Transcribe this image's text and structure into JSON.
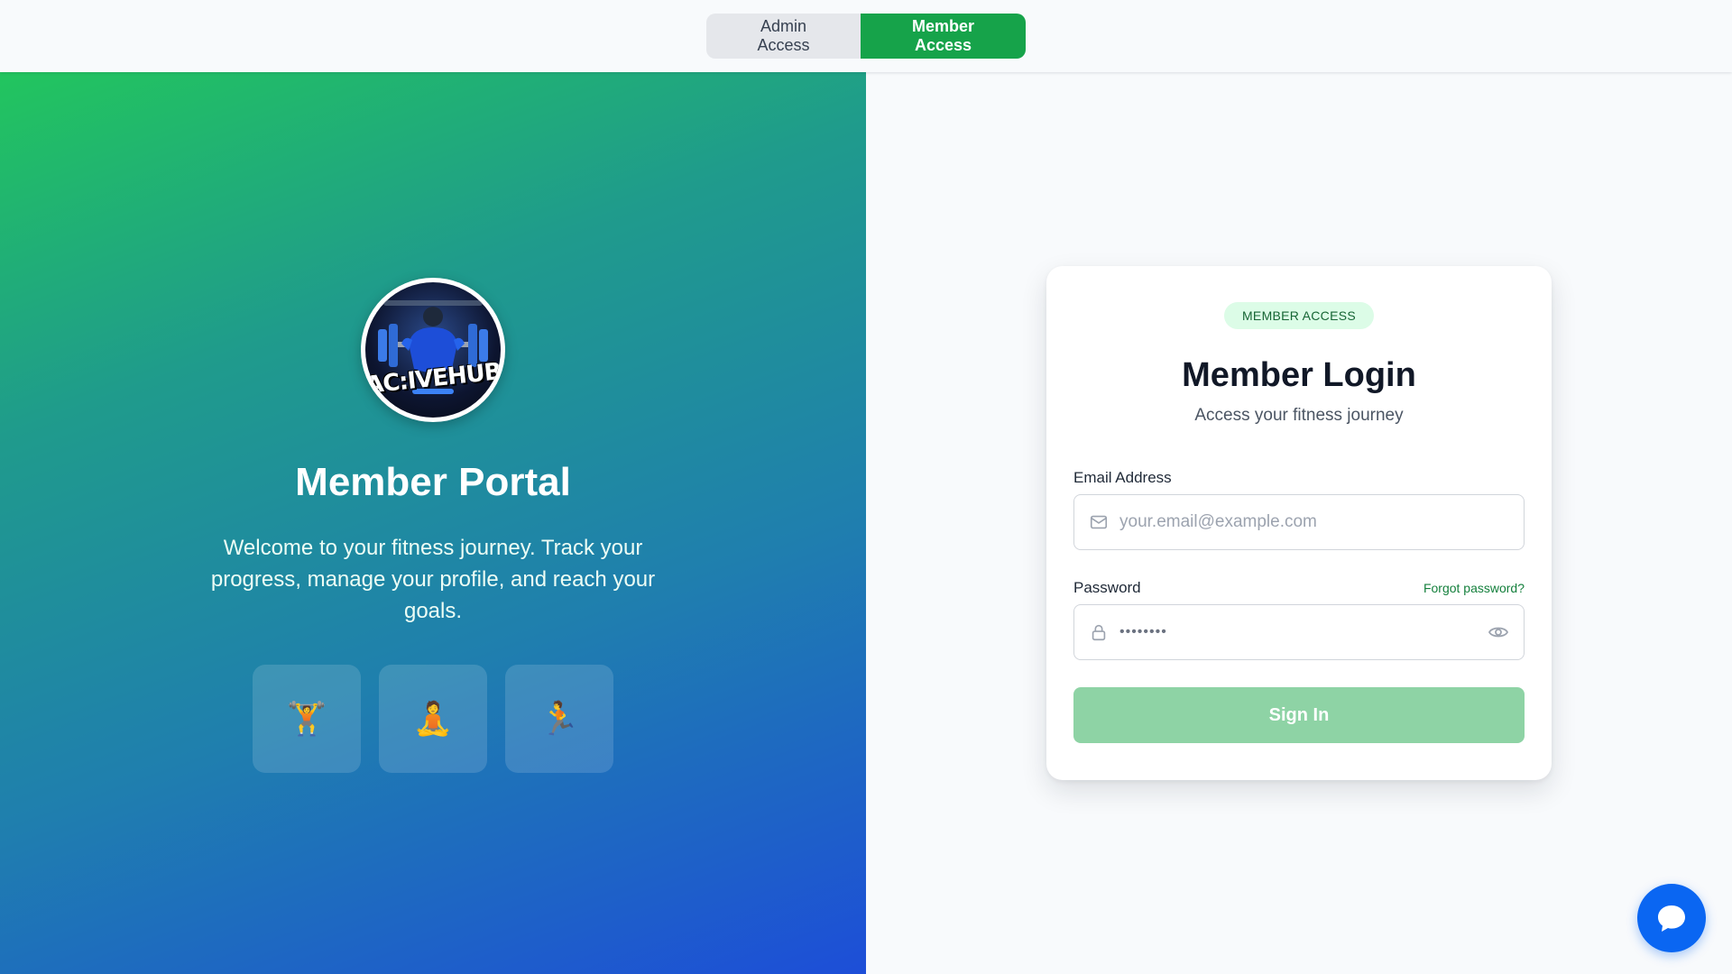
{
  "topbar": {
    "admin_label": "Admin Access",
    "member_label": "Member Access"
  },
  "hero": {
    "logo_text": "AC:IVEHUB",
    "title": "Member Portal",
    "description": "Welcome to your fitness journey. Track your progress, manage your profile, and reach your goals.",
    "tiles": [
      {
        "icon": "weightlifter-icon",
        "glyph": "🏋️"
      },
      {
        "icon": "meditation-icon",
        "glyph": "🧘"
      },
      {
        "icon": "runner-icon",
        "glyph": "🏃"
      }
    ]
  },
  "login": {
    "badge": "MEMBER ACCESS",
    "title": "Member Login",
    "subtitle": "Access your fitness journey",
    "email_label": "Email Address",
    "email_placeholder": "your.email@example.com",
    "password_label": "Password",
    "password_value": "••••••••",
    "forgot_label": "Forgot password?",
    "submit_label": "Sign In"
  },
  "colors": {
    "accent": "#16a34a",
    "submit_disabled": "#8ed3a5",
    "chat": "#0a66f2",
    "gradient_start": "#22c55e",
    "gradient_end": "#1d4ed8"
  },
  "icons": {
    "email": "mail-icon",
    "password": "lock-icon",
    "show_password": "eye-icon",
    "chat": "chat-bubble-icon"
  }
}
